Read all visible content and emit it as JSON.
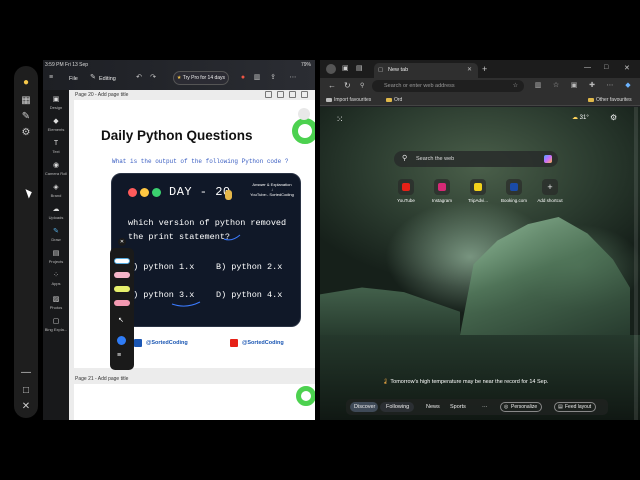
{
  "canva": {
    "status_time": "3:59 PM  Fri 13 Sep",
    "status_battery": "79%",
    "menu_file": "File",
    "menu_editing": "Editing",
    "try_pro": "Try Pro for 14 days",
    "sidebar": [
      {
        "label": "Design",
        "icon": "design-icon"
      },
      {
        "label": "Elements",
        "icon": "elements-icon"
      },
      {
        "label": "Text",
        "icon": "text-icon"
      },
      {
        "label": "Camera Roll",
        "icon": "camera-roll-icon"
      },
      {
        "label": "Brand",
        "icon": "brand-icon"
      },
      {
        "label": "Uploads",
        "icon": "uploads-icon"
      },
      {
        "label": "Draw",
        "icon": "draw-icon"
      },
      {
        "label": "Projects",
        "icon": "projects-icon"
      },
      {
        "label": "Apps",
        "icon": "apps-icon"
      },
      {
        "label": "Photos",
        "icon": "photos-icon"
      },
      {
        "label": "Bing Expla...",
        "icon": "bing-icon"
      }
    ],
    "page20_label": "Page 20 - Add page title",
    "page21_label": "Page 21 - Add page title",
    "title": "Daily Python Questions",
    "question": "What is the output of the following Python code ?",
    "day": "DAY - 20",
    "answer_note_1": "Answer & Explanation",
    "answer_note_2": "↓",
    "answer_note_3": "YouTube:- SortedCoding",
    "qtext_1": "which version of python removed",
    "qtext_2": "the print statement?",
    "options": [
      "A) python 1.x",
      "B) python 2.x",
      "C) python 3.x",
      "D) python 4.x"
    ],
    "footer_left": "@SortedCoding",
    "footer_right": "@SortedCoding"
  },
  "edge": {
    "tab_title": "New tab",
    "address_placeholder": "Search or enter web address",
    "bookmark_import": "Import favourites",
    "bookmark_cs": "Ord",
    "bookmark_other": "Other favourites",
    "weather_temp": "31°",
    "search_placeholder": "Search the web",
    "quick_links": [
      {
        "label": "YouTube",
        "color": "#e62117"
      },
      {
        "label": "Instagram",
        "color": "#d62976"
      },
      {
        "label": "TripAdvi...",
        "color": "#f2d21b"
      },
      {
        "label": "Booking.com",
        "color": "#1a4ba8"
      },
      {
        "label": "Add shortcut",
        "color": "#555555"
      }
    ],
    "tip": "Tomorrow's high temperature may be near the record for 14 Sep.",
    "bottom": {
      "discover": "Discover",
      "following": "Following",
      "news": "News",
      "sports": "Sports",
      "more": "···",
      "personalize": "Personalize",
      "feed_layout": "Feed layout"
    }
  }
}
